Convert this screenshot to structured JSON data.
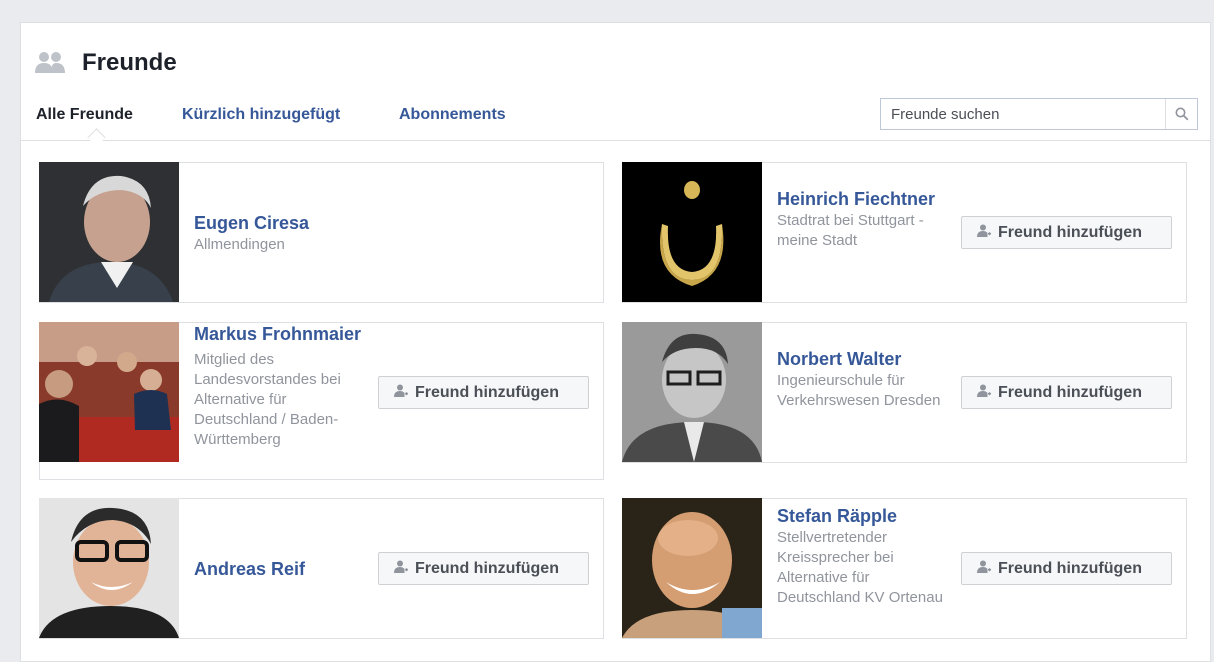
{
  "header": {
    "title": "Freunde",
    "title_icon": "friends-icon"
  },
  "tabs": [
    {
      "label": "Alle Freunde",
      "active": true
    },
    {
      "label": "Kürzlich hinzugefügt",
      "active": false
    },
    {
      "label": "Abonnements",
      "active": false
    }
  ],
  "search": {
    "placeholder": "Freunde suchen",
    "value": "",
    "icon": "search-icon"
  },
  "add_friend_label": "Freund hinzufügen",
  "friends": [
    {
      "name": "Eugen Ciresa",
      "detail": "Allmendingen",
      "has_button": false
    },
    {
      "name": "Heinrich Fiechtner",
      "detail": "Stadtrat bei Stuttgart - meine Stadt",
      "has_button": true
    },
    {
      "name": "Markus Frohnmaier",
      "detail": "Mitglied des Landesvorstandes bei Alternative für Deutschland / Baden-Württemberg",
      "has_button": true
    },
    {
      "name": "Norbert Walter",
      "detail": "Ingenieurschule für Verkehrswesen Dresden",
      "has_button": true
    },
    {
      "name": "Andreas Reif",
      "detail": "",
      "has_button": true
    },
    {
      "name": "Stefan Räpple",
      "detail": "Stellvertretender Kreissprecher bei Alternative für Deutschland KV Ortenau",
      "has_button": true
    }
  ],
  "colors": {
    "link": "#365899",
    "secondary_text": "#90949c",
    "border": "#dddfe2",
    "background": "#e9ebee"
  }
}
